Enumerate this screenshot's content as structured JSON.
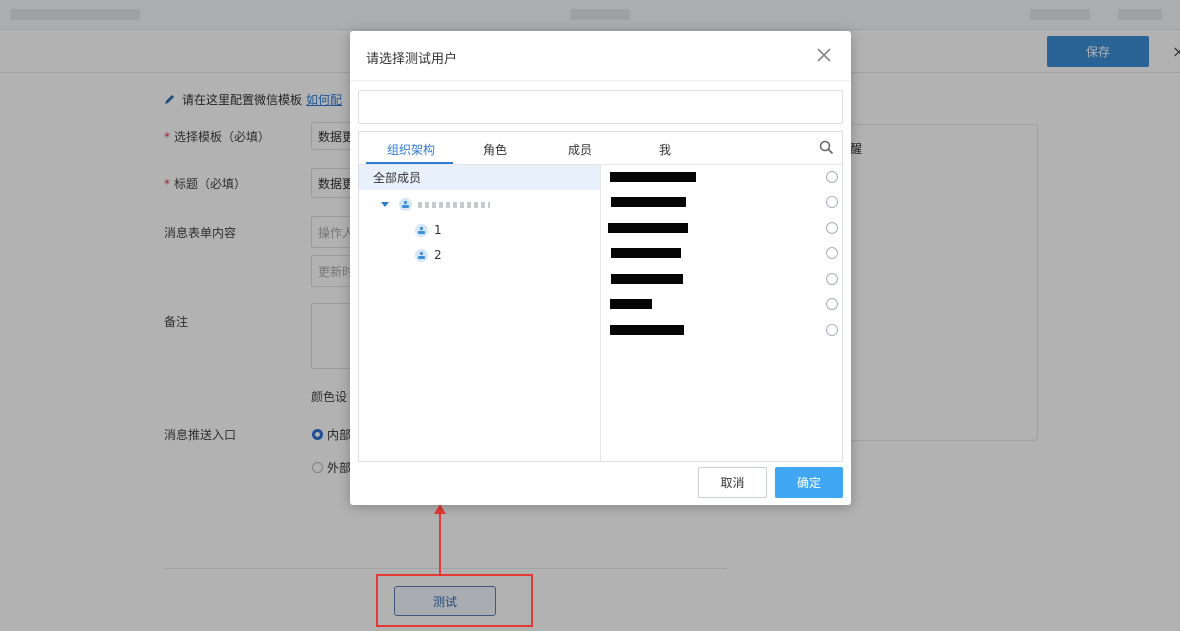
{
  "header": {
    "save_label": "保存"
  },
  "form": {
    "hint_text": "请在这里配置微信模板",
    "hint_link": "如何配",
    "template_label": "选择模板（必填）",
    "template_value": "数据更",
    "title_label": "标题（必填）",
    "title_value": "数据更",
    "message_content_label": "消息表单内容",
    "content_placeholder_1": "操作人",
    "content_placeholder_2": "更新时",
    "remark_label": "备注",
    "color_label": "颜色设",
    "push_entry_label": "消息推送入口",
    "push_internal": "内部",
    "push_external": "外部",
    "preview_text": "醒",
    "test_button": "测试"
  },
  "modal": {
    "title": "请选择测试用户",
    "search_value": "",
    "tabs": [
      {
        "label": "组织架构",
        "active": true
      },
      {
        "label": "角色",
        "active": false
      },
      {
        "label": "成员",
        "active": false
      },
      {
        "label": "我",
        "active": false
      }
    ],
    "tree": {
      "all_members": "全部成员",
      "children": [
        "1",
        "2"
      ]
    },
    "members_count_visible": 7,
    "cancel_label": "取消",
    "confirm_label": "确定"
  },
  "colors": {
    "accent": "#2e7bd6",
    "confirm": "#3fa7f4",
    "save": "#3d8fd6",
    "annotation": "#e53935"
  }
}
